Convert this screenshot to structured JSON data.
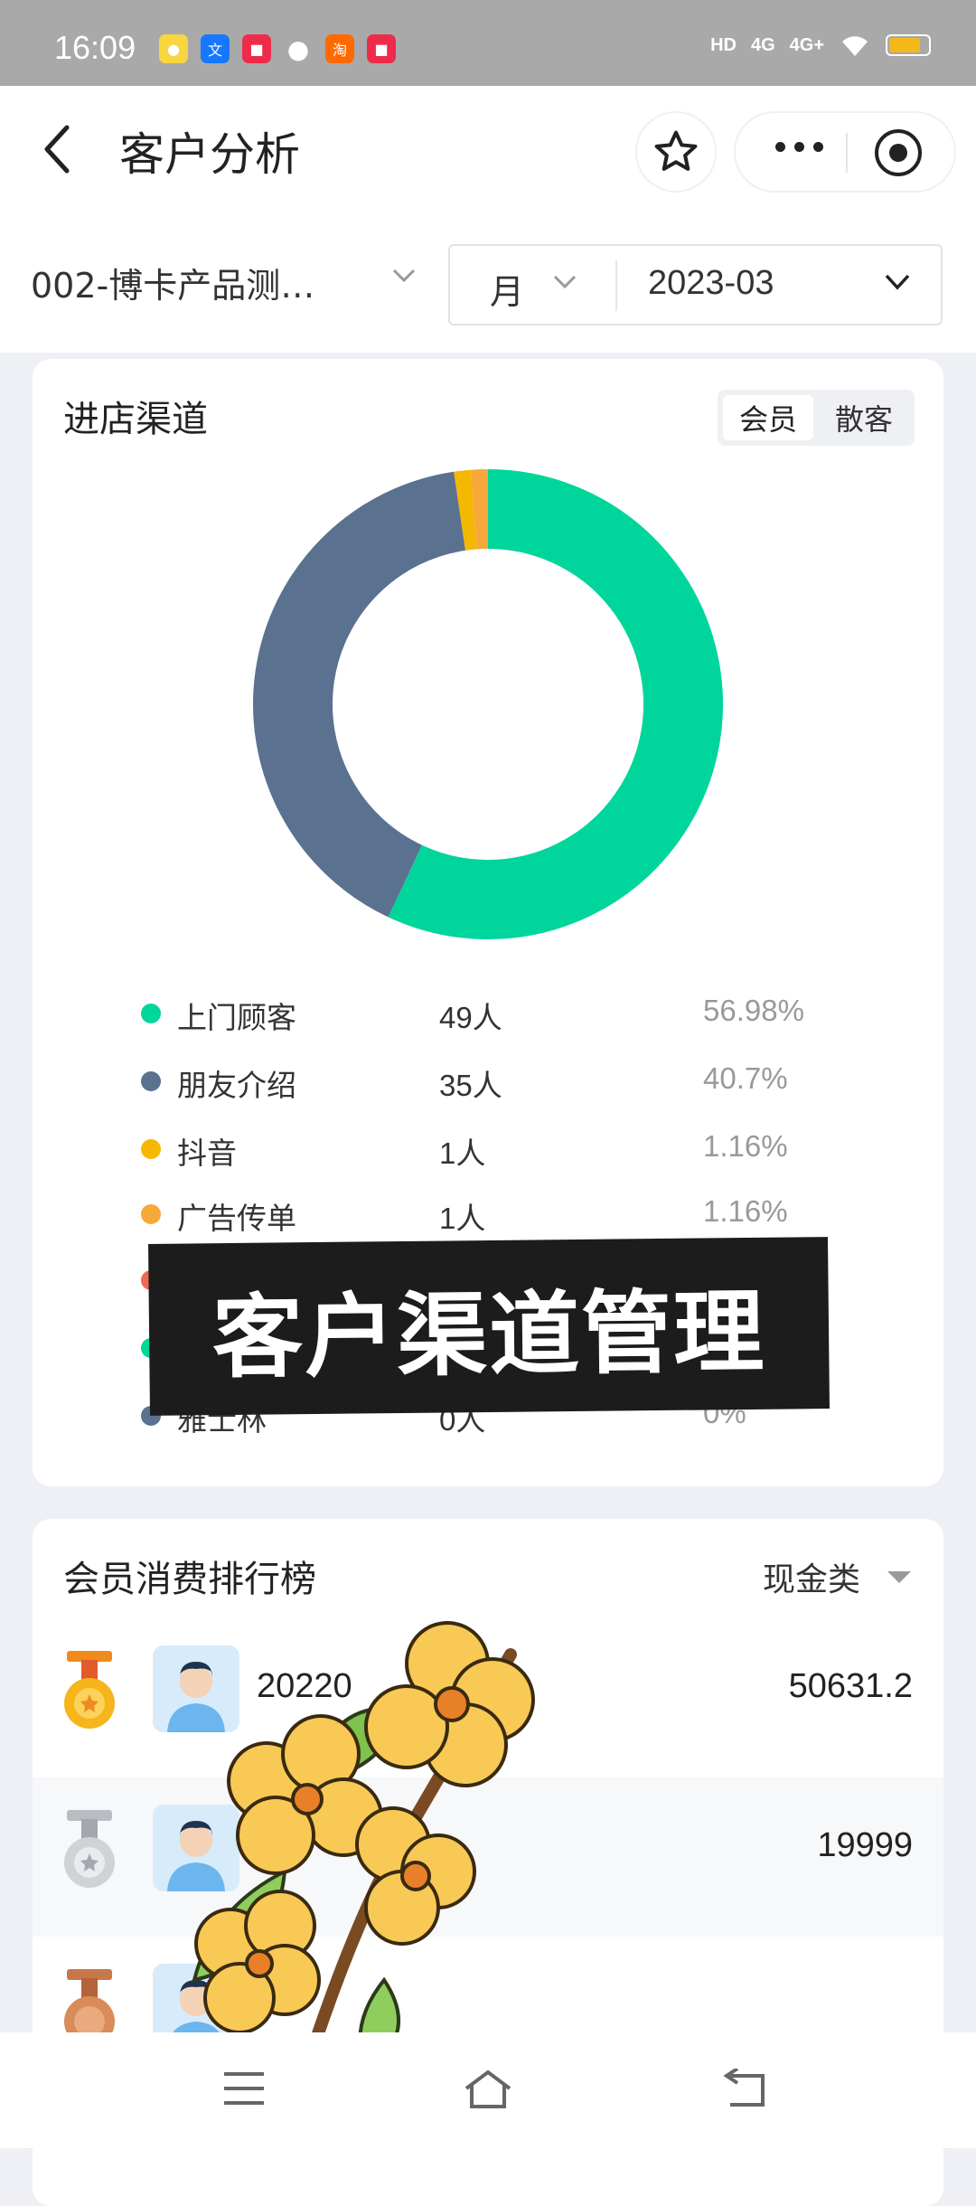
{
  "status_bar": {
    "time": "16:09",
    "network": [
      "HD",
      "4G",
      "4G+"
    ],
    "app_icons": [
      "weibo-icon",
      "alipay-icon",
      "xiaohongshu-icon",
      "message-icon",
      "taobao-icon",
      "xiaohongshu-icon-2"
    ],
    "battery_fraction": 0.7
  },
  "nav": {
    "title": "客户分析"
  },
  "filters": {
    "store": "002-博卡产品测…",
    "period": "月",
    "month": "2023-03"
  },
  "channel_card": {
    "title": "进店渠道",
    "tabs": [
      "会员",
      "散客"
    ],
    "active_tab": "会员",
    "legend": [
      {
        "name": "上门顾客",
        "count": "49人",
        "pct": "56.98%",
        "color": "#00d69c"
      },
      {
        "name": "朋友介绍",
        "count": "35人",
        "pct": "40.7%",
        "color": "#5b7190"
      },
      {
        "name": "抖音",
        "count": "1人",
        "pct": "1.16%",
        "color": "#f5b800"
      },
      {
        "name": "广告传单",
        "count": "1人",
        "pct": "1.16%",
        "color": "#f7a83a"
      },
      {
        "name": "",
        "count": "",
        "pct": "",
        "color": "#ef6a52"
      },
      {
        "name": "",
        "count": "",
        "pct": "",
        "color": "#00d69c"
      },
      {
        "name": "雅士林",
        "count": "0人",
        "pct": "0%",
        "color": "#5b7190"
      }
    ]
  },
  "overlay_banner": "客户渠道管理",
  "ranking_card": {
    "title": "会员消费排行榜",
    "filter": "现金类",
    "rows": [
      {
        "rank_icon": "gold-medal-icon",
        "name": "20220",
        "amount": "50631.2"
      },
      {
        "rank_icon": "silver-medal-icon",
        "name": "",
        "amount": "19999"
      },
      {
        "rank_icon": "bronze-medal-icon",
        "name": "",
        "amount": ""
      }
    ]
  },
  "chart_data": {
    "type": "pie",
    "style": "donut",
    "categories": [
      "上门顾客",
      "朋友介绍",
      "抖音",
      "广告传单"
    ],
    "values": [
      56.98,
      40.7,
      1.16,
      1.16
    ],
    "colors": [
      "#00d69c",
      "#5b7190",
      "#f5b800",
      "#f7a83a"
    ]
  }
}
